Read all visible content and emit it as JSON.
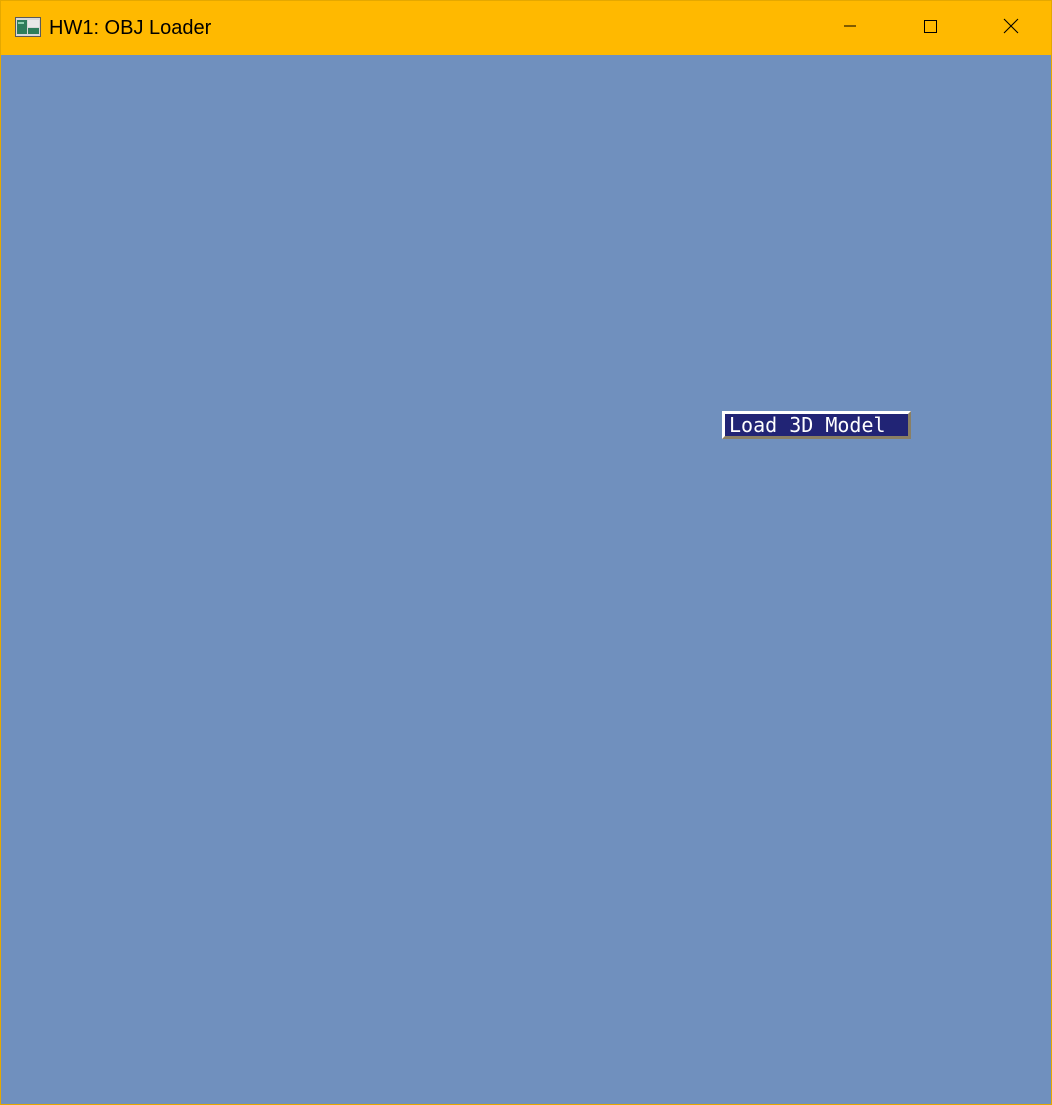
{
  "window": {
    "title": "HW1: OBJ Loader",
    "titlebar_color": "#ffb900",
    "icon": "app-window-icon",
    "controls": {
      "minimize": "minimize-icon",
      "maximize": "maximize-icon",
      "close": "close-icon"
    }
  },
  "canvas": {
    "background_color": "#7090be",
    "load_button": {
      "label": "Load 3D Model",
      "background_color": "#212475",
      "text_color": "#ffffff"
    }
  }
}
